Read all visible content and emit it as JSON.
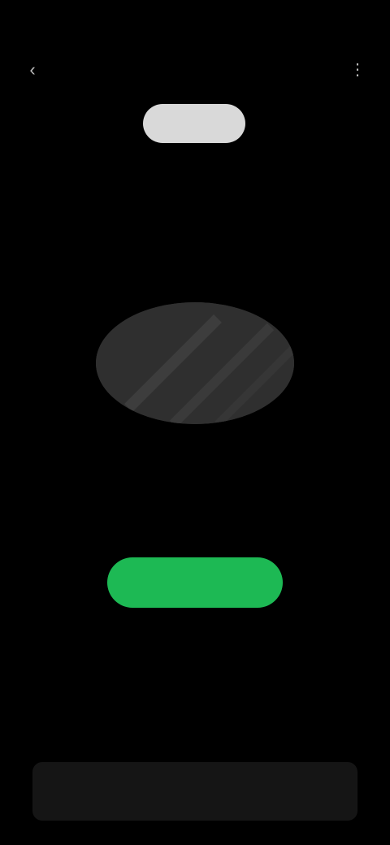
{
  "status_bar": {
    "time": "",
    "indicators": ""
  },
  "nav": {
    "back_icon": "back-arrow-icon",
    "title": "",
    "more_icon": "more-options-icon"
  },
  "tabs": [
    {
      "label": ""
    },
    {
      "label": ""
    },
    {
      "label": "",
      "selected": true
    },
    {
      "label": ""
    },
    {
      "label": ""
    }
  ],
  "empty_state": {
    "illustration": "empty-state-illustration",
    "title": "",
    "subtitle": "",
    "button_label": ""
  },
  "mini_player": {
    "label": ""
  },
  "colors": {
    "background": "#000000",
    "accent": "#1db954",
    "selected_tab": "#d9d9d9",
    "card": "#151515"
  }
}
